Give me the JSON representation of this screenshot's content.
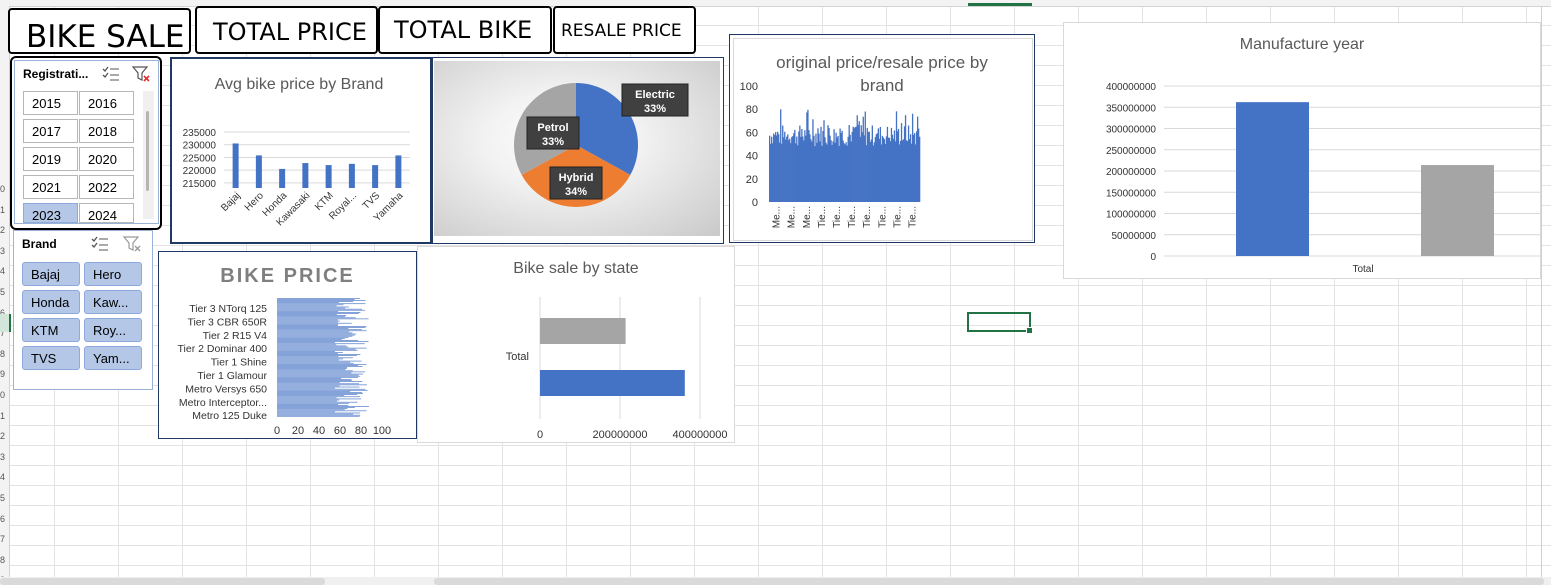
{
  "kpis": [
    {
      "label": "BIKE SALE"
    },
    {
      "label": "TOTAL PRICE"
    },
    {
      "label": "TOTAL BIKE"
    },
    {
      "label": "RESALE PRICE"
    }
  ],
  "row_numbers": [
    "0",
    "1",
    "2",
    "3",
    "4",
    "5",
    "6",
    "7",
    "8",
    "9",
    "0",
    "1",
    "2",
    "3",
    "4",
    "5",
    "6",
    "7",
    "8",
    "9"
  ],
  "slicer_registration": {
    "title": "Registrati...",
    "items": [
      {
        "label": "2015",
        "selected": false
      },
      {
        "label": "2016",
        "selected": false
      },
      {
        "label": "2017",
        "selected": false
      },
      {
        "label": "2018",
        "selected": false
      },
      {
        "label": "2019",
        "selected": false
      },
      {
        "label": "2020",
        "selected": false
      },
      {
        "label": "2021",
        "selected": false
      },
      {
        "label": "2022",
        "selected": false
      },
      {
        "label": "2023",
        "selected": true
      },
      {
        "label": "2024",
        "selected": false
      }
    ]
  },
  "slicer_brand": {
    "title": "Brand",
    "items": [
      "Bajaj",
      "Hero",
      "Honda",
      "Kaw...",
      "KTM",
      "Roy...",
      "TVS",
      "Yam..."
    ]
  },
  "colors": {
    "blue": "#4472c4",
    "orange": "#ed7d31",
    "gray": "#a5a5a5",
    "slicer_selected": "#b4c7e7",
    "excel_green": "#217346"
  },
  "chart_data": [
    {
      "id": "avg-price-by-brand",
      "type": "bar",
      "title": "Avg bike  price by Brand",
      "categories": [
        "Bajaj",
        "Hero",
        "Honda",
        "Kawasaki",
        "KTM",
        "Royal...",
        "TVS",
        "Yamaha"
      ],
      "values": [
        230500,
        225800,
        220500,
        222800,
        222000,
        222500,
        222000,
        225800
      ],
      "yticks": [
        "235000",
        "230000",
        "225000",
        "220000",
        "215000"
      ],
      "ylim": [
        213000,
        235000
      ],
      "grid": true
    },
    {
      "id": "fuel-type-pie",
      "type": "pie",
      "slices": [
        {
          "label": "Electric",
          "percent_label": "33%",
          "value": 33,
          "color": "#4472c4"
        },
        {
          "label": "Hybrid",
          "percent_label": "34%",
          "value": 34,
          "color": "#ed7d31"
        },
        {
          "label": "Petrol",
          "percent_label": "33%",
          "value": 33,
          "color": "#a5a5a5"
        }
      ]
    },
    {
      "id": "original-resale-by-brand",
      "type": "bar",
      "title": "original price/resale price by brand",
      "yticks": [
        "100",
        "80",
        "60",
        "40",
        "20",
        "0"
      ],
      "ylim": [
        0,
        100
      ],
      "xticks": [
        "Me...",
        "Me...",
        "Me...",
        "Tie...",
        "Tie...",
        "Tie...",
        "Tie...",
        "Tie...",
        "Tie...",
        "Tie..."
      ],
      "approx_range": [
        48,
        82
      ]
    },
    {
      "id": "manufacture-year",
      "type": "bar",
      "title": "Manufacture year",
      "categories": [
        "Total"
      ],
      "series": [
        {
          "values": [
            362000000
          ],
          "color": "#4472c4"
        },
        {
          "values": [
            214000000
          ],
          "color": "#a5a5a5"
        }
      ],
      "yticks": [
        "400000000",
        "350000000",
        "300000000",
        "250000000",
        "200000000",
        "150000000",
        "100000000",
        "50000000",
        "0"
      ],
      "ylim": [
        0,
        400000000
      ],
      "grid": true
    },
    {
      "id": "bike-price",
      "type": "bar",
      "title": "BIKE PRICE",
      "orientation": "horizontal",
      "categories": [
        "Tier 3 NTorq 125",
        "Tier 3 CBR 650R",
        "Tier 2 R15 V4",
        "Tier 2 Dominar 400",
        "Tier 1 Shine",
        "Tier 1 Glamour",
        "Metro Versys 650",
        "Metro Interceptor...",
        "Metro 125 Duke"
      ],
      "xticks": [
        "0",
        "20",
        "40",
        "60",
        "80",
        "100"
      ],
      "xlim": [
        0,
        100
      ],
      "approx_range": [
        55,
        88
      ]
    },
    {
      "id": "bike-sale-by-state",
      "type": "bar",
      "orientation": "horizontal",
      "title": "Bike sale by state",
      "categories": [
        "Total"
      ],
      "series": [
        {
          "values": [
            362000000
          ],
          "color": "#4472c4"
        },
        {
          "values": [
            214000000
          ],
          "color": "#a5a5a5"
        }
      ],
      "xticks": [
        "0",
        "200000000",
        "400000000"
      ],
      "xlim": [
        0,
        400000000
      ],
      "grid": true
    }
  ]
}
